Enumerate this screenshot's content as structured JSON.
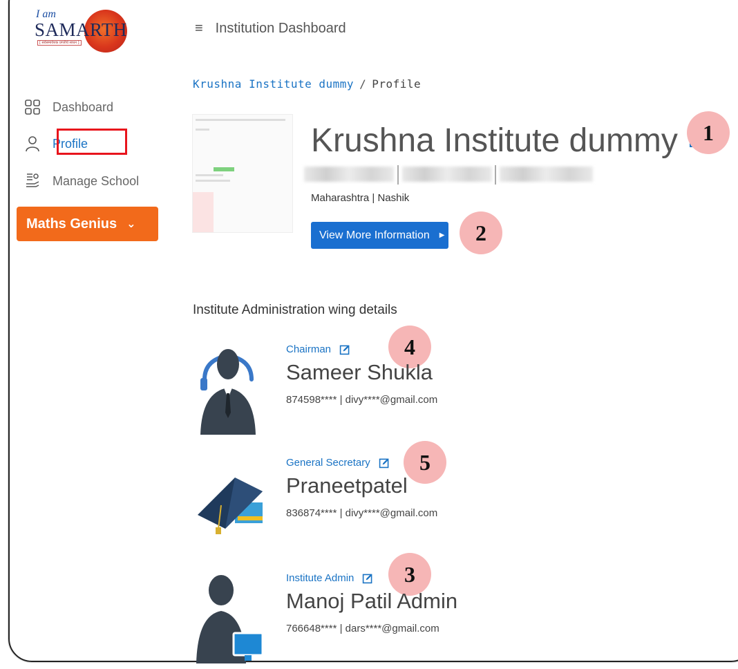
{
  "logo": {
    "top_text": "I am",
    "main_text": "SAMARTH",
    "tagline": "[ सर्वसमावेशक प्रगतीचे साधन ]"
  },
  "sidebar": {
    "items": [
      {
        "label": "Dashboard",
        "icon": "grid-icon"
      },
      {
        "label": "Profile",
        "icon": "user-icon",
        "active": true
      },
      {
        "label": "Manage School",
        "icon": "school-icon"
      }
    ],
    "cta": {
      "label": "Maths Genius"
    }
  },
  "header": {
    "title": "Institution Dashboard"
  },
  "breadcrumb": {
    "link": "Krushna Institute dummy",
    "separator": "/",
    "current": "Profile"
  },
  "institute": {
    "name": "Krushna Institute dummy",
    "location": "Maharashtra | Nashik",
    "view_button": "View More Information"
  },
  "section_title": "Institute Administration wing details",
  "people": [
    {
      "role": "Chairman",
      "name": "Sameer Shukla",
      "contact": "874598**** | divy****@gmail.com"
    },
    {
      "role": "General Secretary",
      "name": "Praneetpatel",
      "contact": "836874**** | divy****@gmail.com"
    },
    {
      "role": "Institute Admin",
      "name": "Manoj Patil Admin",
      "contact": "766648**** | dars****@gmail.com"
    }
  ],
  "badges": [
    "1",
    "2",
    "4",
    "5",
    "3"
  ],
  "colors": {
    "accent": "#1a73c4",
    "cta": "#f26a1b",
    "highlight": "#e8141c",
    "badge": "#f6b6b6"
  }
}
